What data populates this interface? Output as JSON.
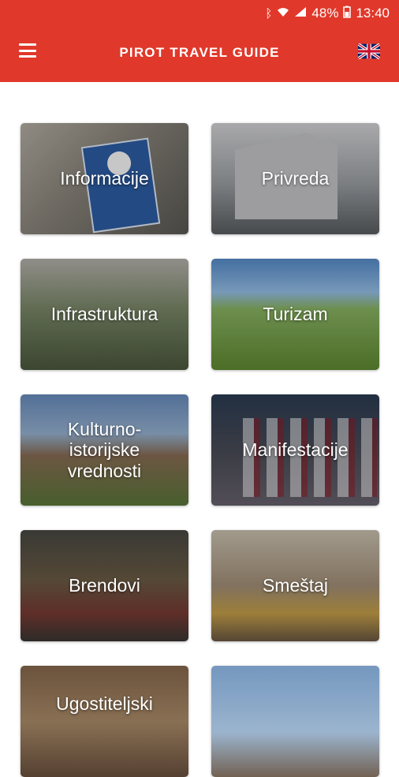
{
  "statusbar": {
    "bluetooth": "ᛒ",
    "wifi": "wifi",
    "signal": "signal",
    "battery": "48%",
    "time": "13:40"
  },
  "appbar": {
    "title": "PIROT TRAVEL GUIDE",
    "menu_icon": "hamburger-menu-icon",
    "language_icon": "uk-flag-icon"
  },
  "tiles": [
    {
      "label": "Informacije"
    },
    {
      "label": "Privreda"
    },
    {
      "label": "Infrastruktura"
    },
    {
      "label": "Turizam"
    },
    {
      "label": "Kulturno-\nistorijske\nvrednosti"
    },
    {
      "label": "Manifestacije"
    },
    {
      "label": "Brendovi"
    },
    {
      "label": "Smeštaj"
    },
    {
      "label": "Ugostiteljski"
    },
    {
      "label": ""
    }
  ],
  "colors": {
    "primary": "#e0382a",
    "background": "#ffffff"
  }
}
